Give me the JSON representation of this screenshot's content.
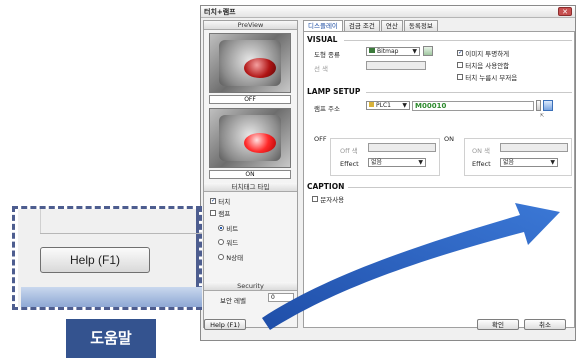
{
  "window": {
    "title": "터치+램프",
    "close_label": "✕"
  },
  "left_panel": {
    "preview_header": "PreView",
    "off_caption": "OFF",
    "on_caption": "ON",
    "touch_tag_type_header": "터치태그 타입",
    "touch_tag_options": [
      {
        "label": "터치",
        "checked": true
      },
      {
        "label": "램프",
        "checked": false
      }
    ],
    "mode_options": [
      {
        "label": "비트",
        "selected": true
      },
      {
        "label": "워드",
        "selected": false
      },
      {
        "label": "N상태",
        "selected": false
      }
    ],
    "security_header": "Security",
    "security_level_label": "보안 레벨",
    "security_level_value": "0"
  },
  "tabs": [
    "디스플레이",
    "검금 조건",
    "연산",
    "동록정보"
  ],
  "visual": {
    "section_title": "VISUAL",
    "shape_type_label": "도형 종류",
    "shape_type_value": "Bitmap",
    "color_label": "선 색",
    "image_transparent_label": "이미지 투명하게",
    "image_transparent_checked": true,
    "touch_disabled_label": "터치음 사용안함",
    "touch_disabled_checked": false,
    "touch_sound_label": "터치 누름시 부저음",
    "touch_sound_checked": false
  },
  "lamp_setup": {
    "section_title": "LAMP SETUP",
    "lamp_address_label": "램프 주소",
    "plc_value": "PLC1",
    "address_value": "M00010",
    "off_label": "OFF",
    "on_label": "ON",
    "off_color_label": "Off 색",
    "on_color_label": "ON 색",
    "effect_label": "Effect",
    "off_effect_value": "없음",
    "on_effect_value": "없음"
  },
  "caption": {
    "section_title": "CAPTION",
    "use_text_label": "문자사용",
    "use_text_checked": false
  },
  "buttons": {
    "help": "Help (F1)",
    "ok": "확인",
    "cancel": "취소"
  },
  "zoom": {
    "help_button_label": "Help (F1)",
    "callout_label": "도움말"
  },
  "colors": {
    "accent_blue": "#34538f",
    "tab_active_text": "#1d4da3",
    "address_green": "#2e8b2e",
    "arrow_blue": "#2a5db0"
  }
}
